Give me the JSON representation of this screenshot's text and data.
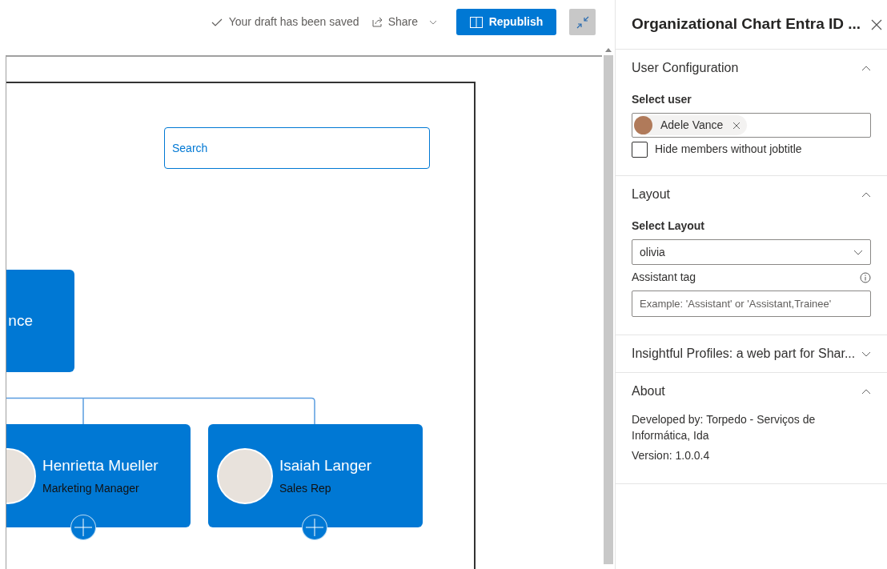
{
  "toolbar": {
    "save_status": "Your draft has been saved",
    "share_label": "Share",
    "republish_label": "Republish"
  },
  "canvas": {
    "search": {
      "placeholder": "Search"
    },
    "root": {
      "name": "nce"
    },
    "nodes": [
      {
        "name": "Henrietta Mueller",
        "title": "Marketing Manager"
      },
      {
        "name": "Isaiah Langer",
        "title": "Sales Rep"
      }
    ]
  },
  "panel": {
    "title": "Organizational Chart Entra ID ...",
    "sections": [
      {
        "title": "User Configuration",
        "expanded": true,
        "fields": [
          {
            "kind": "people",
            "label": "Select user",
            "person": "Adele Vance"
          },
          {
            "kind": "checkbox",
            "label": "Hide members without jobtitle",
            "checked": false
          }
        ]
      },
      {
        "title": "Layout",
        "expanded": true,
        "fields": [
          {
            "kind": "dropdown",
            "label": "Select Layout",
            "value": "olivia"
          },
          {
            "kind": "text",
            "label": "Assistant tag",
            "placeholder": "Example: 'Assistant' or 'Assistant,Trainee'"
          }
        ]
      },
      {
        "title": "Insightful Profiles: a web part for Shar...",
        "expanded": false
      },
      {
        "title": "About",
        "expanded": true,
        "fields": [
          {
            "kind": "note",
            "text": "Developed by: Torpedo - Serviços de Informática, Ida"
          },
          {
            "kind": "note",
            "text": "Version: 1.0.0.4"
          }
        ]
      }
    ]
  }
}
